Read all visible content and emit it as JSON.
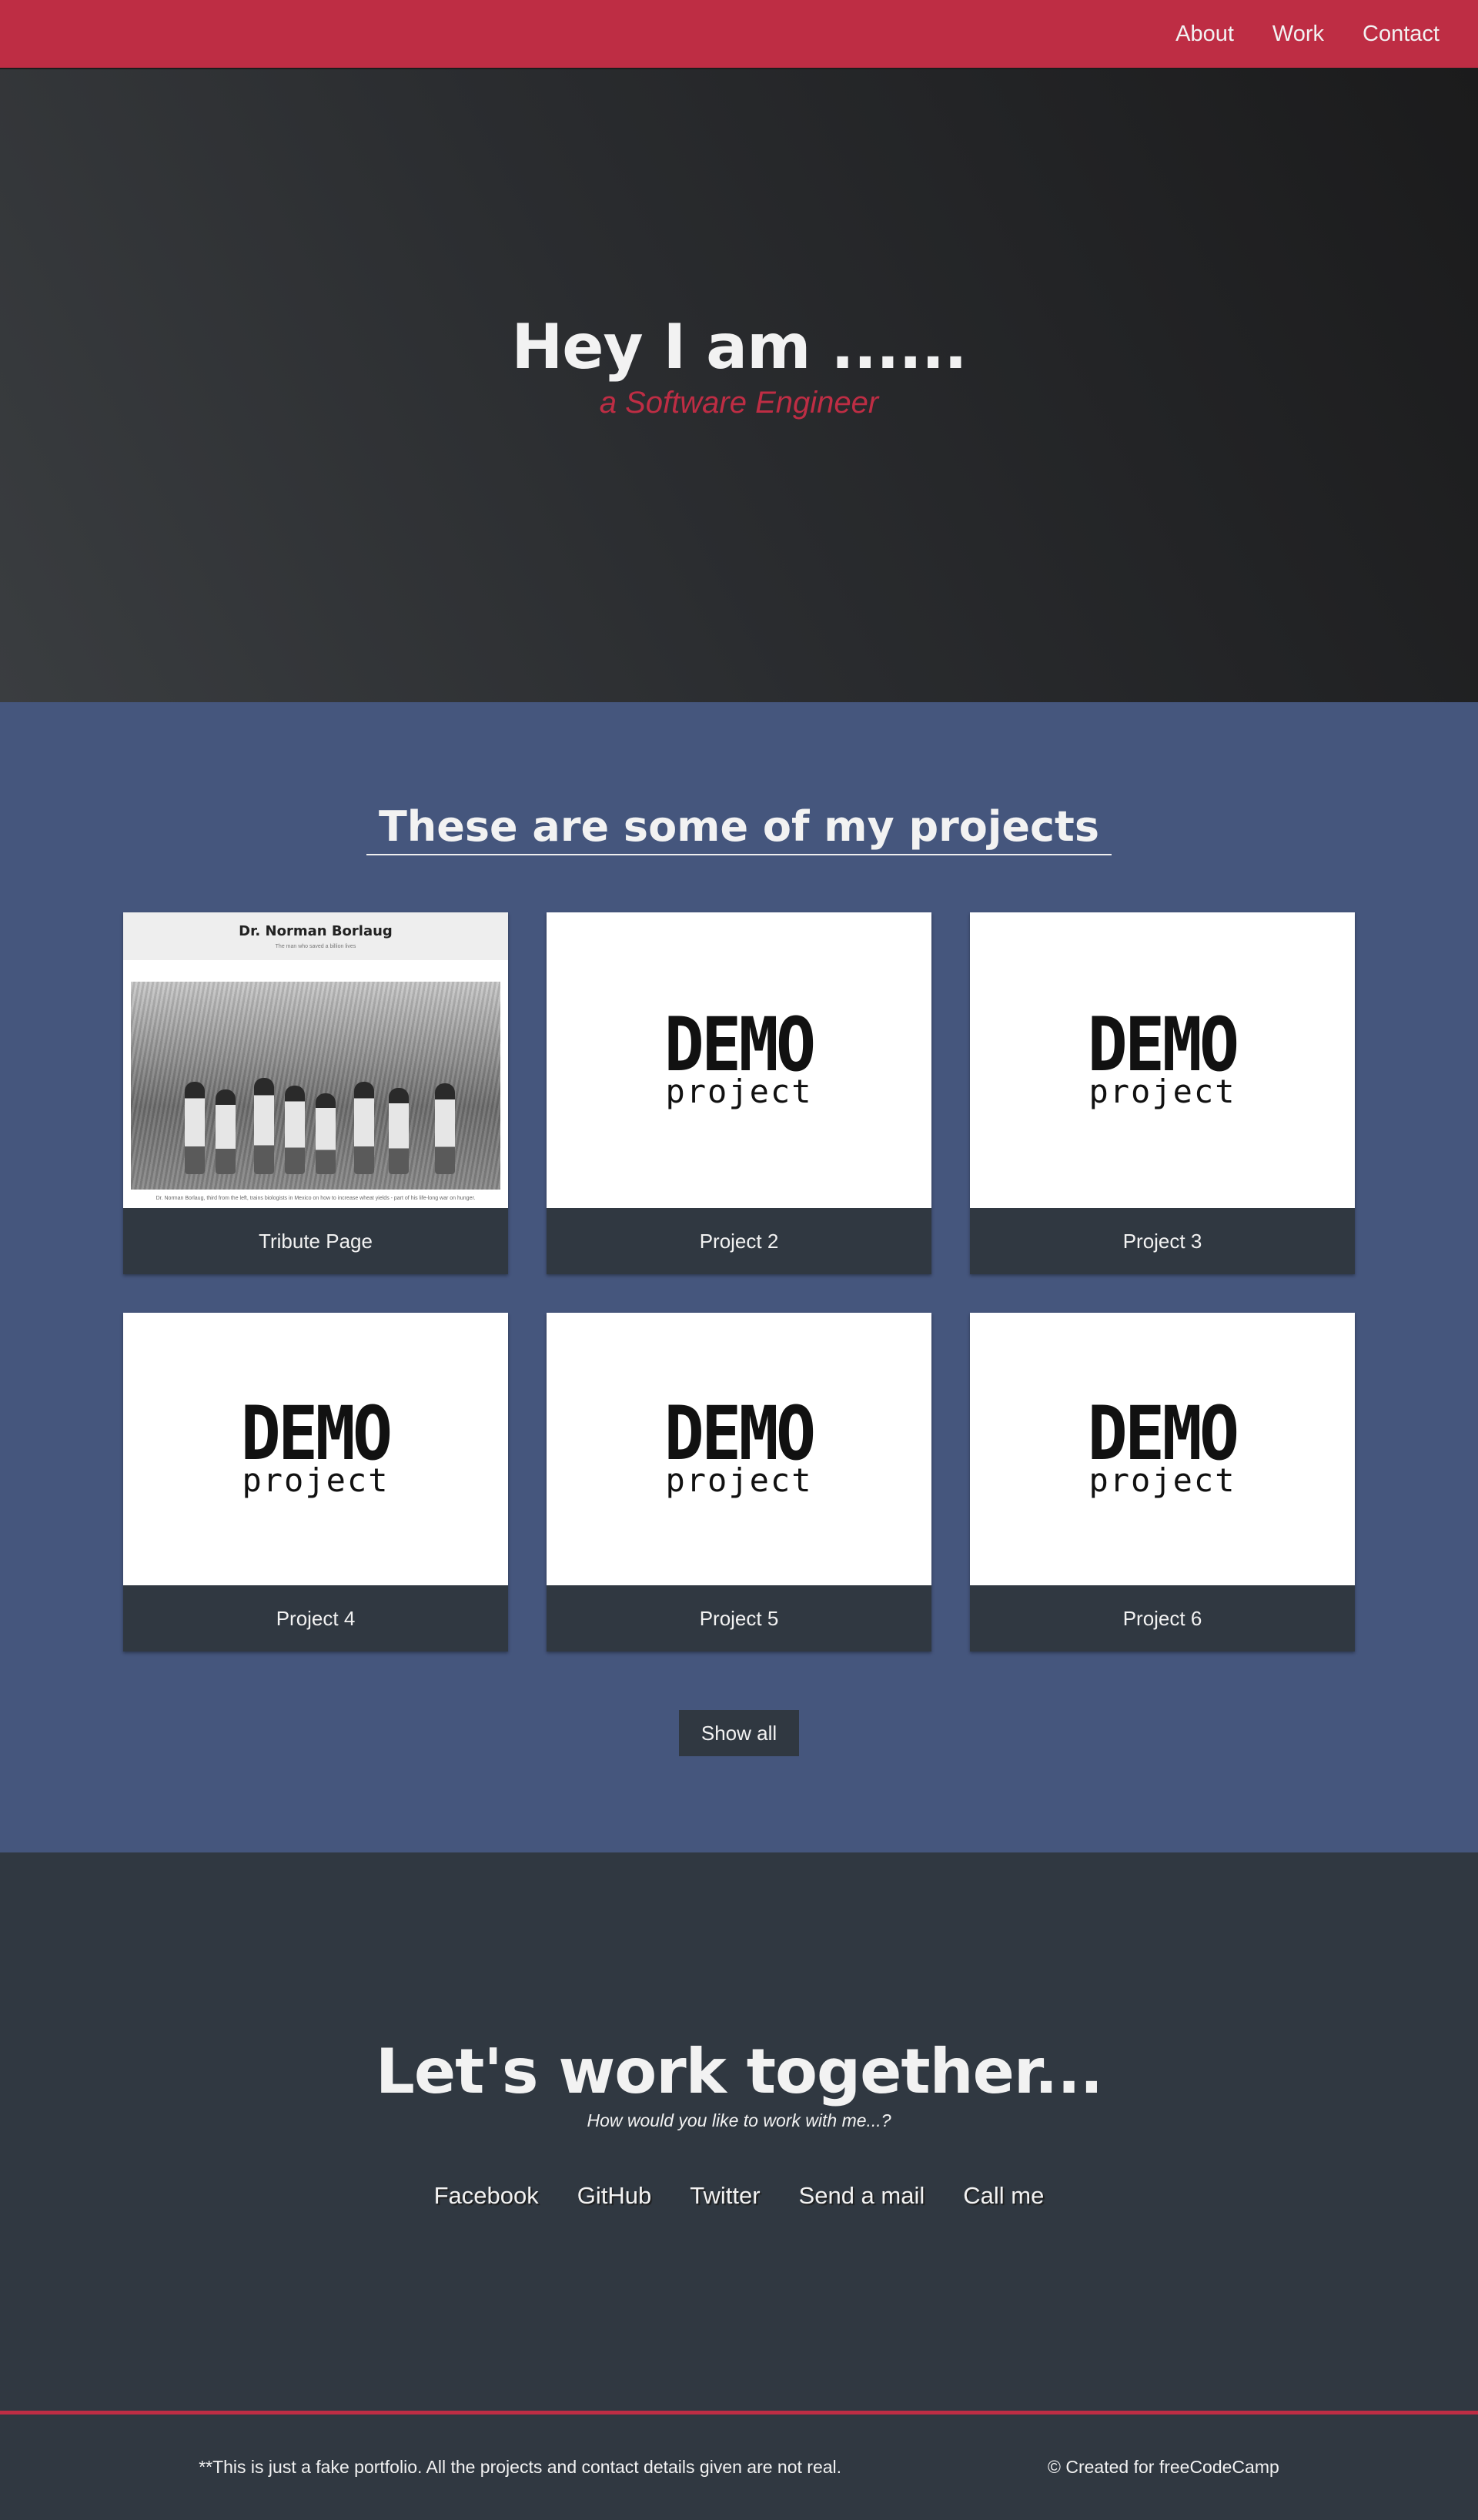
{
  "nav": {
    "items": [
      {
        "label": "About"
      },
      {
        "label": "Work"
      },
      {
        "label": "Contact"
      }
    ]
  },
  "hero": {
    "title": "Hey I am ......",
    "subtitle": "a Software Engineer"
  },
  "projects": {
    "heading": "These are some of my projects",
    "items": [
      {
        "label": "Tribute Page",
        "image": "tribute-screenshot",
        "tribute_title": "Dr. Norman Borlaug",
        "tribute_subtitle": "The man who saved a billion lives",
        "tribute_caption": "Dr. Norman Borlaug, third from the left, trains biologists in Mexico on how to increase wheat yields - part of his life-long war on hunger."
      },
      {
        "label": "Project 2",
        "image": "demo-project",
        "demo_big": "DEMO",
        "demo_small": "project"
      },
      {
        "label": "Project 3",
        "image": "demo-project",
        "demo_big": "DEMO",
        "demo_small": "project"
      },
      {
        "label": "Project 4",
        "image": "demo-project",
        "demo_big": "DEMO",
        "demo_small": "project"
      },
      {
        "label": "Project 5",
        "image": "demo-project",
        "demo_big": "DEMO",
        "demo_small": "project"
      },
      {
        "label": "Project 6",
        "image": "demo-project",
        "demo_big": "DEMO",
        "demo_small": "project"
      }
    ],
    "show_all_label": "Show all"
  },
  "contact": {
    "heading": "Let's work together...",
    "subheading": "How would you like to work with me...?",
    "links": [
      {
        "label": "Facebook"
      },
      {
        "label": "GitHub"
      },
      {
        "label": "Twitter"
      },
      {
        "label": "Send a mail"
      },
      {
        "label": "Call me"
      }
    ]
  },
  "footer": {
    "disclaimer": "**This is just a fake portfolio. All the projects and contact details given are not real.",
    "credit": "© Created for freeCodeCamp"
  },
  "colors": {
    "nav_bg": "#be2d44",
    "accent": "#be2d44",
    "projects_bg": "#45567d",
    "dark_bg": "#303841"
  }
}
